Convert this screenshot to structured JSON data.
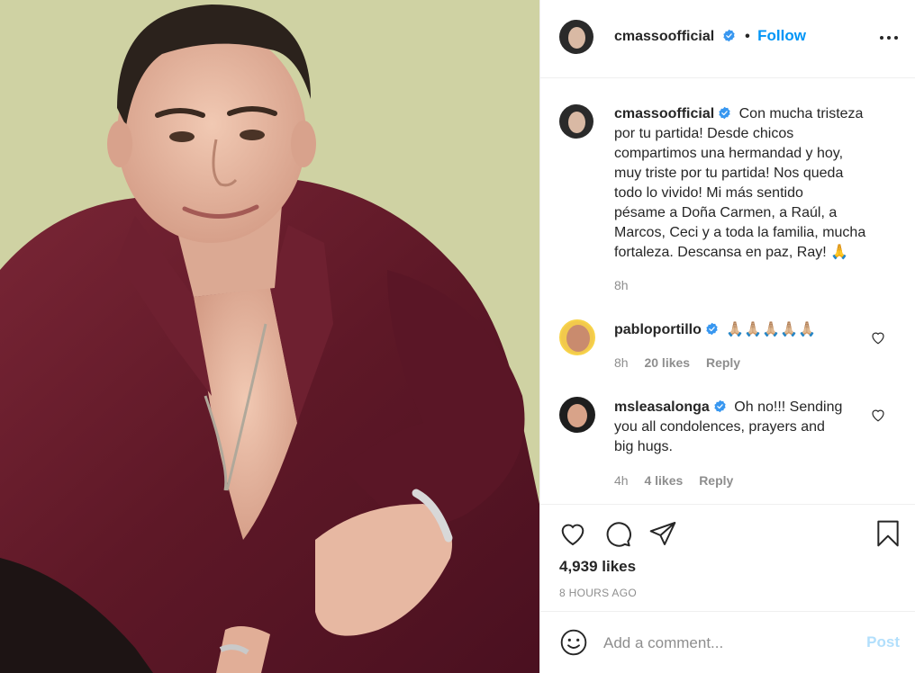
{
  "photo": {
    "alt_subject": "man-in-burgundy-shirt"
  },
  "header": {
    "username": "cmassoofficial",
    "separator": "•",
    "follow_label": "Follow"
  },
  "caption": {
    "username": "cmassoofficial",
    "lines": [
      "Con mucha tristeza",
      "por tu partida! Desde chicos",
      "compartimos una hermandad y hoy,",
      "muy triste por tu partida! Nos queda",
      "todo lo vivido! Mi más sentido",
      "pésame a Doña Carmen, a Raúl, a",
      "Marcos, Ceci y a toda la familia, mucha",
      "fortaleza. Descansa en paz, Ray! 🙏"
    ],
    "age": "8h"
  },
  "comments": [
    {
      "username": "pabloportillo",
      "text": "🙏🏼🙏🏼🙏🏼🙏🏼🙏🏼",
      "age": "8h",
      "likes": "20 likes",
      "reply": "Reply"
    },
    {
      "username": "msleasalonga",
      "lines": [
        "Oh no!!! Sending",
        "you all condolences, prayers and",
        "big hugs."
      ],
      "age": "4h",
      "likes": "4 likes",
      "reply": "Reply"
    }
  ],
  "actions": {
    "likes_count": "4,939 likes",
    "timestamp": "8 HOURS AGO"
  },
  "composer": {
    "placeholder": "Add a comment...",
    "post_label": "Post"
  },
  "colors": {
    "accent": "#0095f6",
    "post_disabled": "#b2dffc",
    "secondary_text": "#8e8e8e",
    "shirt": "#6b1f2e"
  }
}
